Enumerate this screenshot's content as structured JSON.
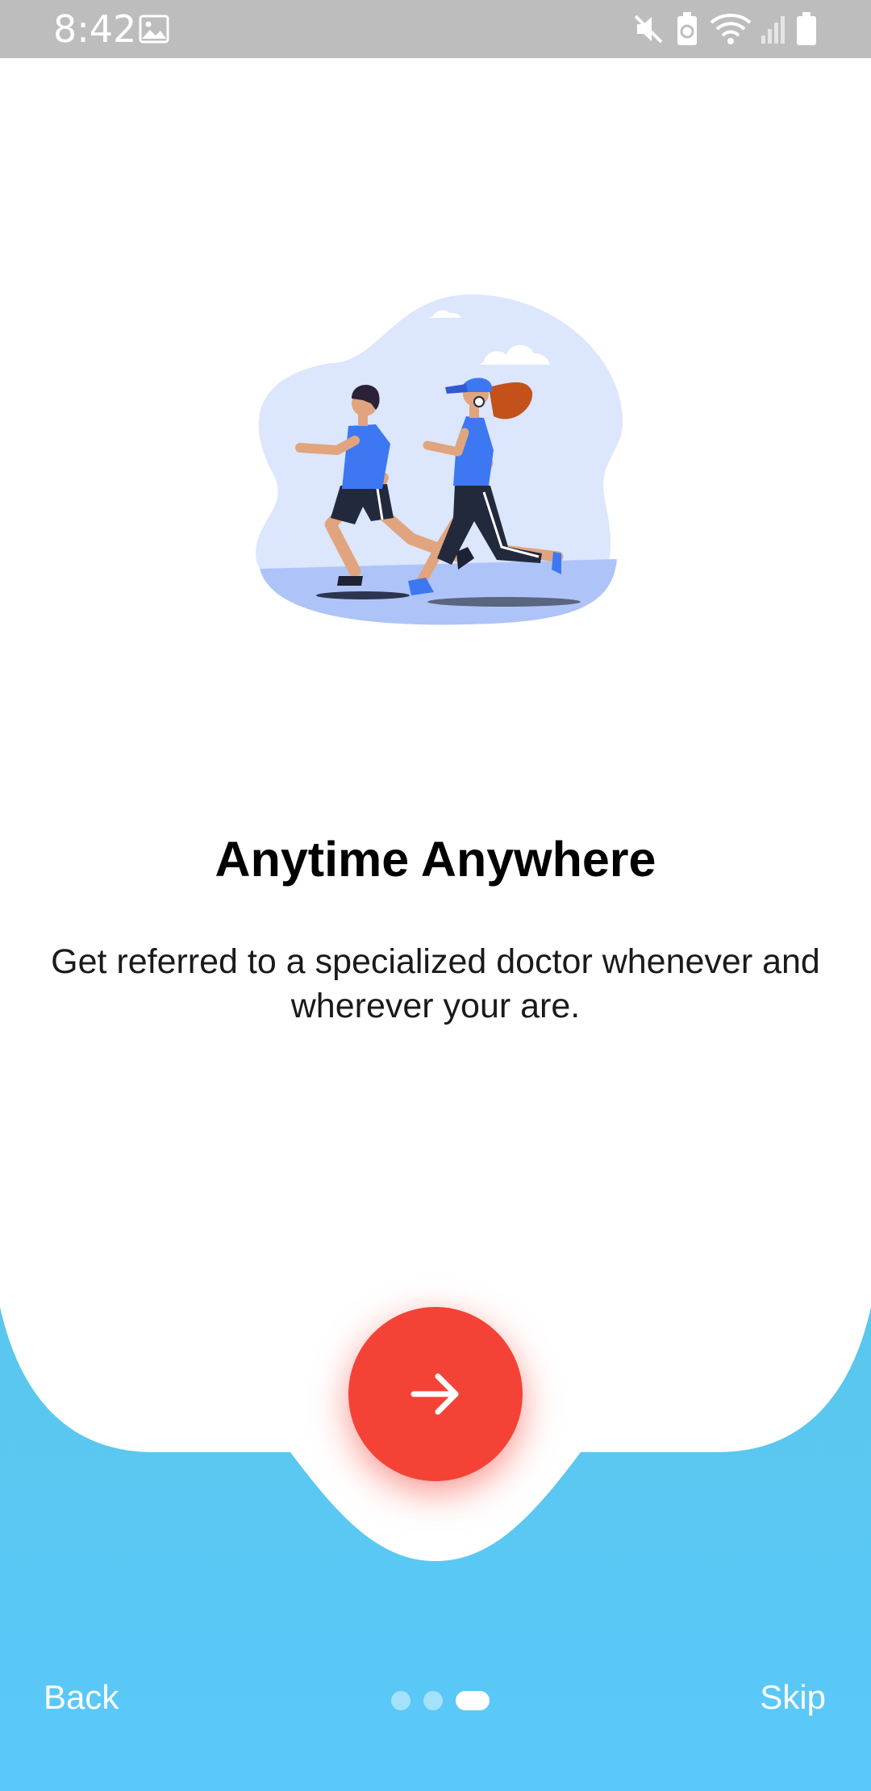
{
  "status_bar": {
    "time": "8:42",
    "icons": [
      "image-icon",
      "mute-icon",
      "battery-saver-icon",
      "wifi-icon",
      "signal-icon",
      "battery-icon"
    ]
  },
  "onboarding": {
    "title": "Anytime Anywhere",
    "description": "Get referred to a specialized doctor whenever and wherever your are.",
    "next_icon": "arrow-right-icon",
    "page_count": 3,
    "current_page": 3
  },
  "navigation": {
    "back_label": "Back",
    "skip_label": "Skip"
  },
  "colors": {
    "status_bar": "#bdbdbd",
    "accent": "#f44336",
    "bottom_gradient_top": "#5ac7ec",
    "bottom_gradient_bottom": "#5ac8fa",
    "illustration_blob": "#dce6fc"
  }
}
